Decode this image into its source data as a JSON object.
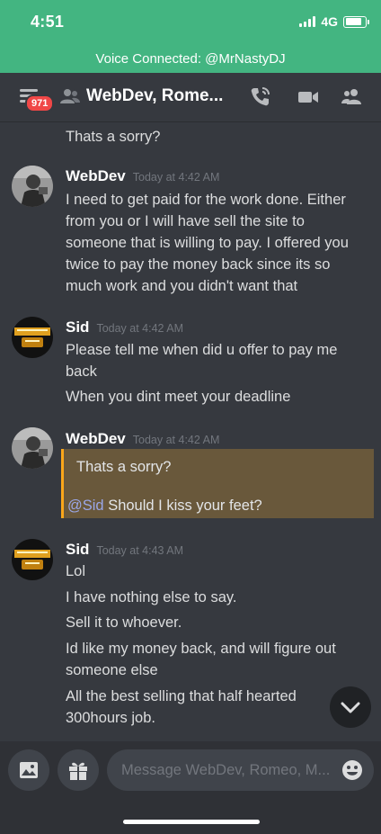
{
  "status_bar": {
    "time": "4:51",
    "network": "4G"
  },
  "voice_bar": {
    "text": "Voice Connected: @MrNastyDJ"
  },
  "header": {
    "badge": "971",
    "title": "WebDev, Rome..."
  },
  "top_fragment": "Thats a sorry?",
  "messages": [
    {
      "author": "WebDev",
      "timestamp": "Today at 4:42 AM",
      "lines": [
        "I need to get paid for the work done. Either",
        "from you or I will have sell the site to",
        "someone that is willing to pay. I offered you",
        "twice to pay the money back since its so",
        "much work and you didn't want that"
      ]
    },
    {
      "author": "Sid",
      "timestamp": "Today at 4:42 AM",
      "lines": [
        "Please tell me when did u offer to pay me",
        "back",
        "When you dint meet your deadline"
      ]
    },
    {
      "author": "WebDev",
      "timestamp": "Today at 4:42 AM",
      "quote": "Thats a sorry?",
      "mention": "@Sid",
      "reply": " Should I kiss your feet?"
    },
    {
      "author": "Sid",
      "timestamp": "Today at 4:43 AM",
      "lines": [
        "Lol",
        "I have nothing else to say.",
        "Sell it to whoever.",
        "Id like my money back, and will figure out",
        "someone else",
        "All the best selling that half hearted",
        "300hours job."
      ]
    }
  ],
  "composer": {
    "placeholder": "Message WebDev, Romeo, M..."
  },
  "icons": {
    "menu": "hamburger-icon",
    "group": "group-dm-icon",
    "call": "phone-call-icon",
    "video": "video-icon",
    "members": "members-icon",
    "image": "image-icon",
    "gift": "gift-icon",
    "emoji": "emoji-icon",
    "scroll": "chevron-down-icon"
  },
  "colors": {
    "status_green": "#43b581",
    "background": "#36393f",
    "badge_red": "#f04747",
    "quote_highlight": "#69583b",
    "quote_bar": "#faa61a",
    "mention": "#9aa7e8"
  }
}
